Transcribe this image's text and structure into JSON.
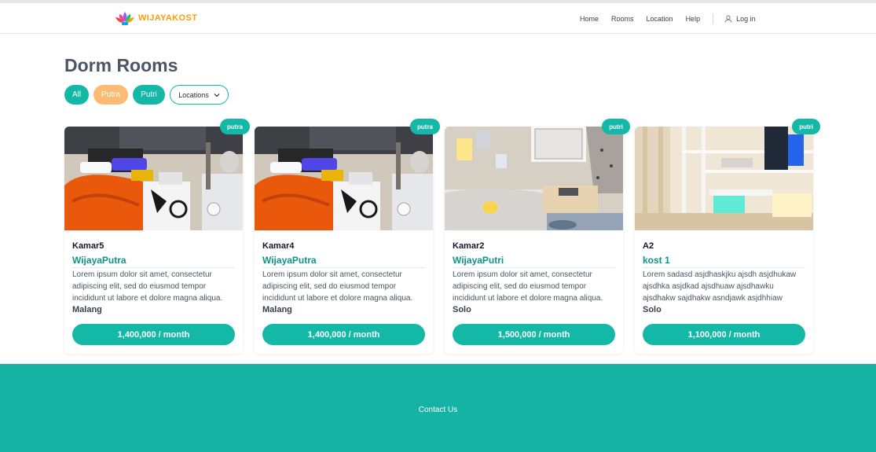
{
  "brand": {
    "name": "WIJAYAKOST",
    "logo_icon": "lotus-logo-icon"
  },
  "nav": {
    "links": [
      "Home",
      "Rooms",
      "Location",
      "Help"
    ],
    "login": "Log in",
    "login_icon": "user-icon"
  },
  "page": {
    "title": "Dorm Rooms"
  },
  "filters": {
    "all": "All",
    "putra": "Putra",
    "putri": "Putri",
    "locations": "Locations",
    "locations_icon": "chevron-down-icon"
  },
  "rooms": [
    {
      "badge": "putra",
      "name": "Kamar5",
      "kost": "WijayaPutra",
      "description": "Lorem ipsum dolor sit amet, consectetur adipiscing elit, sed do eiusmod tempor incididunt ut labore et dolore magna aliqua.",
      "city": "Malang",
      "price": "1,400,000 / month"
    },
    {
      "badge": "putra",
      "name": "Kamar4",
      "kost": "WijayaPutra",
      "description": "Lorem ipsum dolor sit amet, consectetur adipiscing elit, sed do eiusmod tempor incididunt ut labore et dolore magna aliqua.",
      "city": "Malang",
      "price": "1,400,000 / month"
    },
    {
      "badge": "putri",
      "name": "Kamar2",
      "kost": "WijayaPutri",
      "description": "Lorem ipsum dolor sit amet, consectetur adipiscing elit, sed do eiusmod tempor incididunt ut labore et dolore magna aliqua.",
      "city": "Solo",
      "price": "1,500,000 / month"
    },
    {
      "badge": "putri",
      "name": "A2",
      "kost": "kost 1",
      "description": "Lorem sadasd asjdhaskjku ajsdh asjdhukaw ajsdhka asjdkad ajsdhuaw ajsdhawku ajsdhakw sajdhakw asndjawk asjdhhiaw",
      "city": "Solo",
      "price": "1,100,000 / month"
    }
  ],
  "footer": {
    "link": "Contact Us"
  },
  "colors": {
    "accent": "#14b8a6",
    "putra_pill": "#fdba74",
    "footer": "#14b3a3"
  }
}
